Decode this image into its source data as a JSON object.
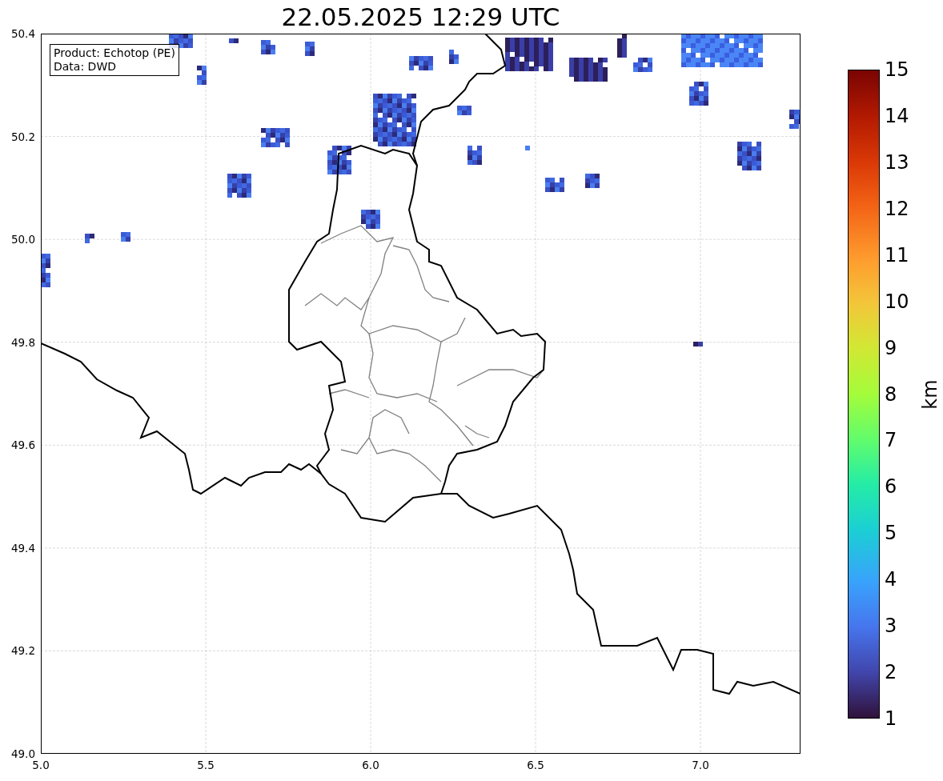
{
  "title": "22.05.2025 12:29 UTC",
  "legend": [
    "Product: Echotop (PE)",
    "Data: DWD"
  ],
  "y_ticks": [
    "50.4",
    "50.2",
    "50.0",
    "49.8",
    "49.6",
    "49.4",
    "49.2",
    "49.0"
  ],
  "x_ticks": [
    "5.0",
    "5.5",
    "6.0",
    "6.5",
    "7.0"
  ],
  "colorbar": {
    "label": "km",
    "ticks": [
      "15",
      "14",
      "13",
      "12",
      "11",
      "10",
      "9",
      "8",
      "7",
      "6",
      "5",
      "4",
      "3",
      "2",
      "1"
    ]
  }
}
